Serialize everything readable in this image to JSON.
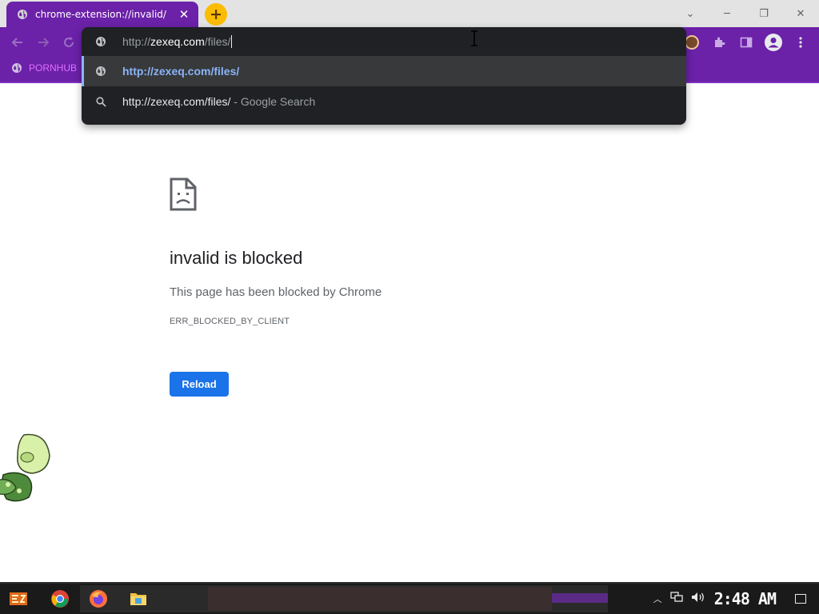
{
  "tab": {
    "title": "chrome-extension://invalid/",
    "close_glyph": "✕",
    "favicon": "globe-icon"
  },
  "new_tab": {
    "glyph": "+"
  },
  "window_controls": {
    "minimize": "─",
    "restore": "❐",
    "close": "✕",
    "tabsearch": "⌄"
  },
  "bookmarks": [
    {
      "label": "PORNHUB",
      "icon": "globe-icon"
    }
  ],
  "omnibox": {
    "input_scheme": "http://",
    "input_host": "zexeq.com",
    "input_path": "/files/",
    "suggestions": [
      {
        "text": "http://zexeq.com/files/",
        "suffix": "",
        "icon": "globe-icon"
      },
      {
        "text": "http://zexeq.com/files/",
        "suffix": "- Google Search",
        "icon": "search-icon"
      }
    ]
  },
  "error": {
    "title": "invalid is blocked",
    "description": "This page has been blocked by Chrome",
    "code": "ERR_BLOCKED_BY_CLIENT",
    "reload_label": "Reload"
  },
  "taskbar": {
    "clock": "2:48 AM",
    "apps": [
      "start-icon",
      "chrome-icon",
      "firefox-icon",
      "file-explorer-icon"
    ]
  },
  "colors": {
    "theme_purple": "#6b21a8",
    "omnibox_bg": "#202124",
    "link_blue": "#8ab4f8",
    "button_blue": "#1a73e8"
  }
}
